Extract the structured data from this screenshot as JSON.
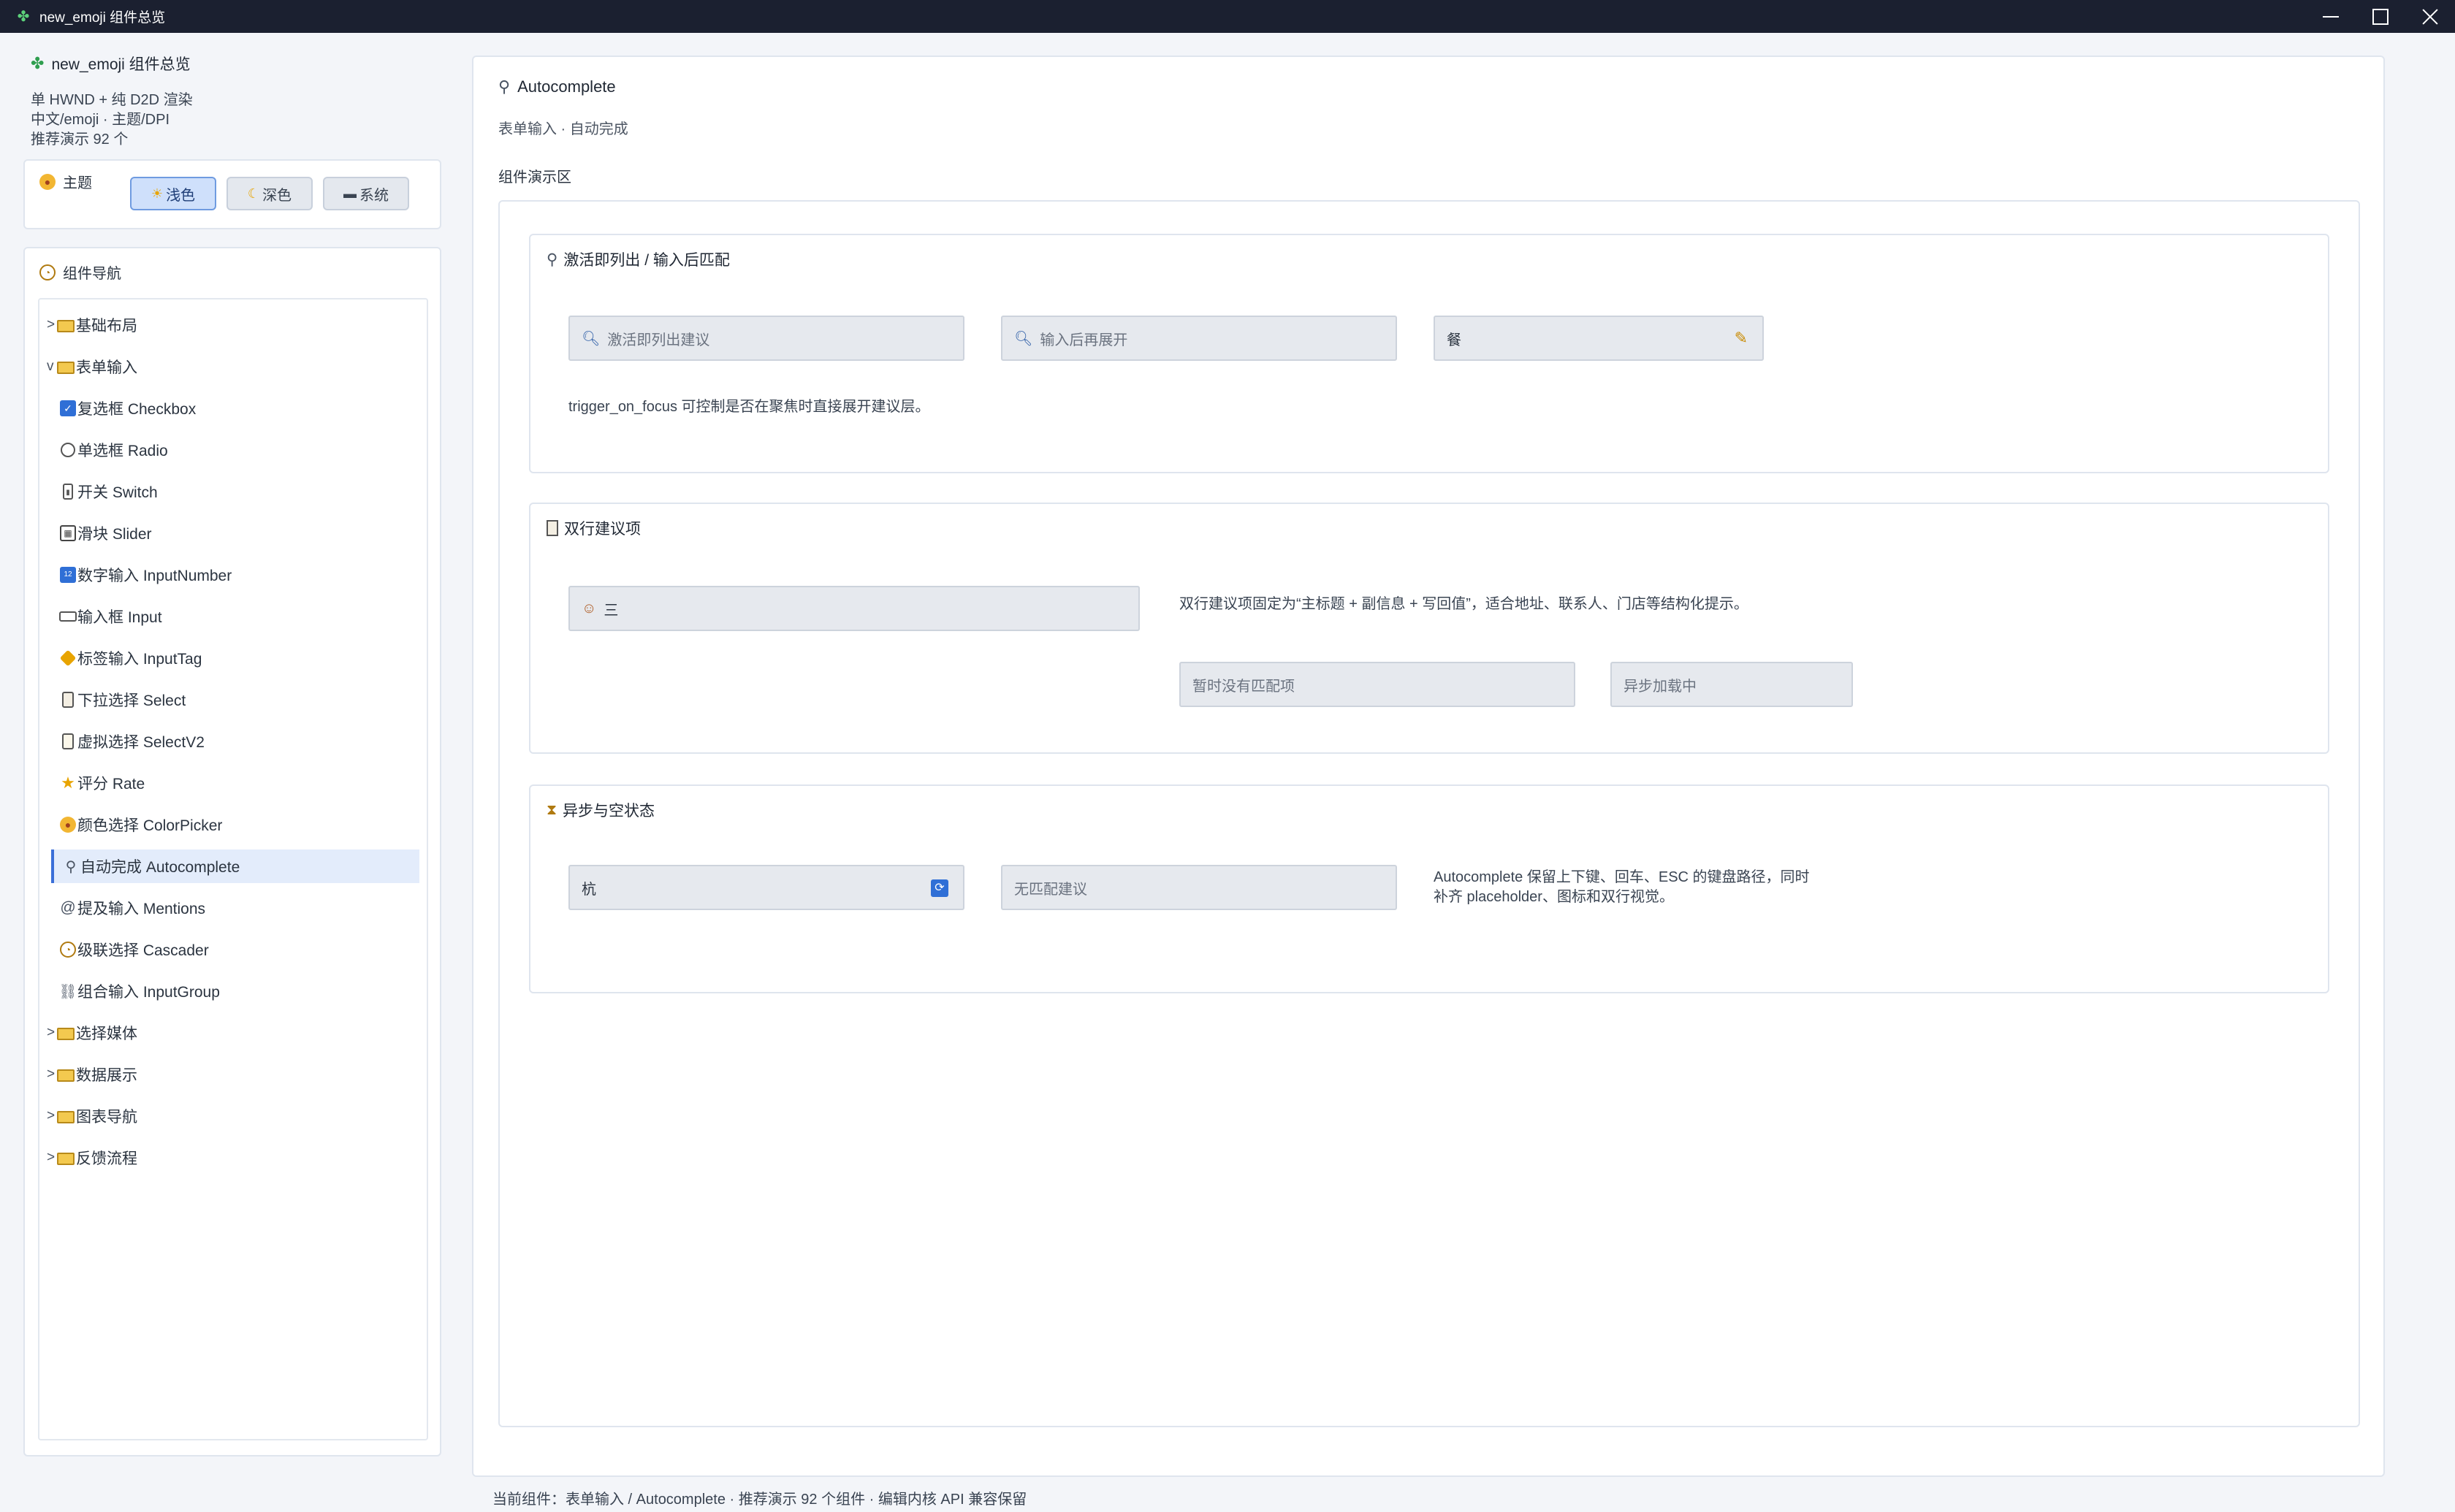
{
  "window": {
    "title": "new_emoji 组件总览"
  },
  "app": {
    "title": "new_emoji 组件总览",
    "info_lines": [
      "单 HWND + 纯 D2D 渲染",
      "中文/emoji · 主题/DPI",
      "推荐演示 92 个"
    ]
  },
  "theme": {
    "label": "主题",
    "buttons": [
      {
        "label": "浅色",
        "icon": "sun-icon",
        "active": true
      },
      {
        "label": "深色",
        "icon": "moon-icon",
        "active": false
      },
      {
        "label": "系统",
        "icon": "laptop-icon",
        "active": false
      }
    ]
  },
  "nav": {
    "label": "组件导航",
    "items": [
      {
        "label": "基础布局",
        "type": "group",
        "arrow": ">",
        "icon": "folder-icon"
      },
      {
        "label": "表单输入",
        "type": "group",
        "arrow": "v",
        "icon": "folder-icon"
      },
      {
        "label": "复选框 Checkbox",
        "type": "child",
        "icon": "checkbox-icon"
      },
      {
        "label": "单选框 Radio",
        "type": "child",
        "icon": "radio-icon"
      },
      {
        "label": "开关 Switch",
        "type": "child",
        "icon": "switch-icon"
      },
      {
        "label": "滑块 Slider",
        "type": "child",
        "icon": "slider-icon"
      },
      {
        "label": "数字输入 InputNumber",
        "type": "child",
        "icon": "numbers-icon"
      },
      {
        "label": "输入框 Input",
        "type": "child",
        "icon": "keyboard-icon"
      },
      {
        "label": "标签输入 InputTag",
        "type": "child",
        "icon": "tag-icon"
      },
      {
        "label": "下拉选择 Select",
        "type": "child",
        "icon": "clipboard-icon"
      },
      {
        "label": "虚拟选择 SelectV2",
        "type": "child",
        "icon": "scroll-icon"
      },
      {
        "label": "评分 Rate",
        "type": "child",
        "icon": "star-icon"
      },
      {
        "label": "颜色选择 ColorPicker",
        "type": "child",
        "icon": "palette-icon"
      },
      {
        "label": "自动完成 Autocomplete",
        "type": "child",
        "icon": "magnifier-icon",
        "selected": true
      },
      {
        "label": "提及输入 Mentions",
        "type": "child",
        "icon": "at-icon"
      },
      {
        "label": "级联选择 Cascader",
        "type": "child",
        "icon": "compass-icon"
      },
      {
        "label": "组合输入 InputGroup",
        "type": "child",
        "icon": "link-icon"
      },
      {
        "label": "选择媒体",
        "type": "group",
        "arrow": ">",
        "icon": "folder-icon"
      },
      {
        "label": "数据展示",
        "type": "group",
        "arrow": ">",
        "icon": "folder-icon"
      },
      {
        "label": "图表导航",
        "type": "group",
        "arrow": ">",
        "icon": "folder-icon"
      },
      {
        "label": "反馈流程",
        "type": "group",
        "arrow": ">",
        "icon": "folder-icon"
      }
    ]
  },
  "main": {
    "title": "Autocomplete",
    "subtitle": "表单输入 · 自动完成",
    "demo_label": "组件演示区",
    "sections": [
      {
        "title": "激活即列出 / 输入后匹配",
        "icon": "magnifier-icon",
        "fields": [
          {
            "placeholder": "激活即列出建议",
            "value": "",
            "icon": "search-icon"
          },
          {
            "placeholder": "输入后再展开",
            "value": "",
            "icon": "search-icon"
          },
          {
            "placeholder": "",
            "value": "餐",
            "icon": "pencil-icon"
          }
        ],
        "description": "trigger_on_focus 可控制是否在聚焦时直接展开建议层。"
      },
      {
        "title": "双行建议项",
        "icon": "clipboard-icon",
        "fields": [
          {
            "placeholder": "",
            "value": "三",
            "icon": "person-icon"
          },
          {
            "placeholder": "暂时没有匹配项",
            "value": ""
          },
          {
            "placeholder": "异步加载中",
            "value": ""
          }
        ],
        "description": "双行建议项固定为“主标题 + 副信息 + 写回值”，适合地址、联系人、门店等结构化提示。"
      },
      {
        "title": "异步与空状态",
        "icon": "hourglass-icon",
        "fields": [
          {
            "placeholder": "",
            "value": "杭",
            "icon": "spinner-icon"
          },
          {
            "placeholder": "无匹配建议",
            "value": ""
          }
        ],
        "description_lines": [
          "Autocomplete 保留上下键、回车、ESC 的键盘路径，同时",
          "补齐 placeholder、图标和双行视觉。"
        ]
      }
    ]
  },
  "status": {
    "text": "当前组件：表单输入 / Autocomplete · 推荐演示 92 个组件 · 编辑内核 API 兼容保留"
  }
}
